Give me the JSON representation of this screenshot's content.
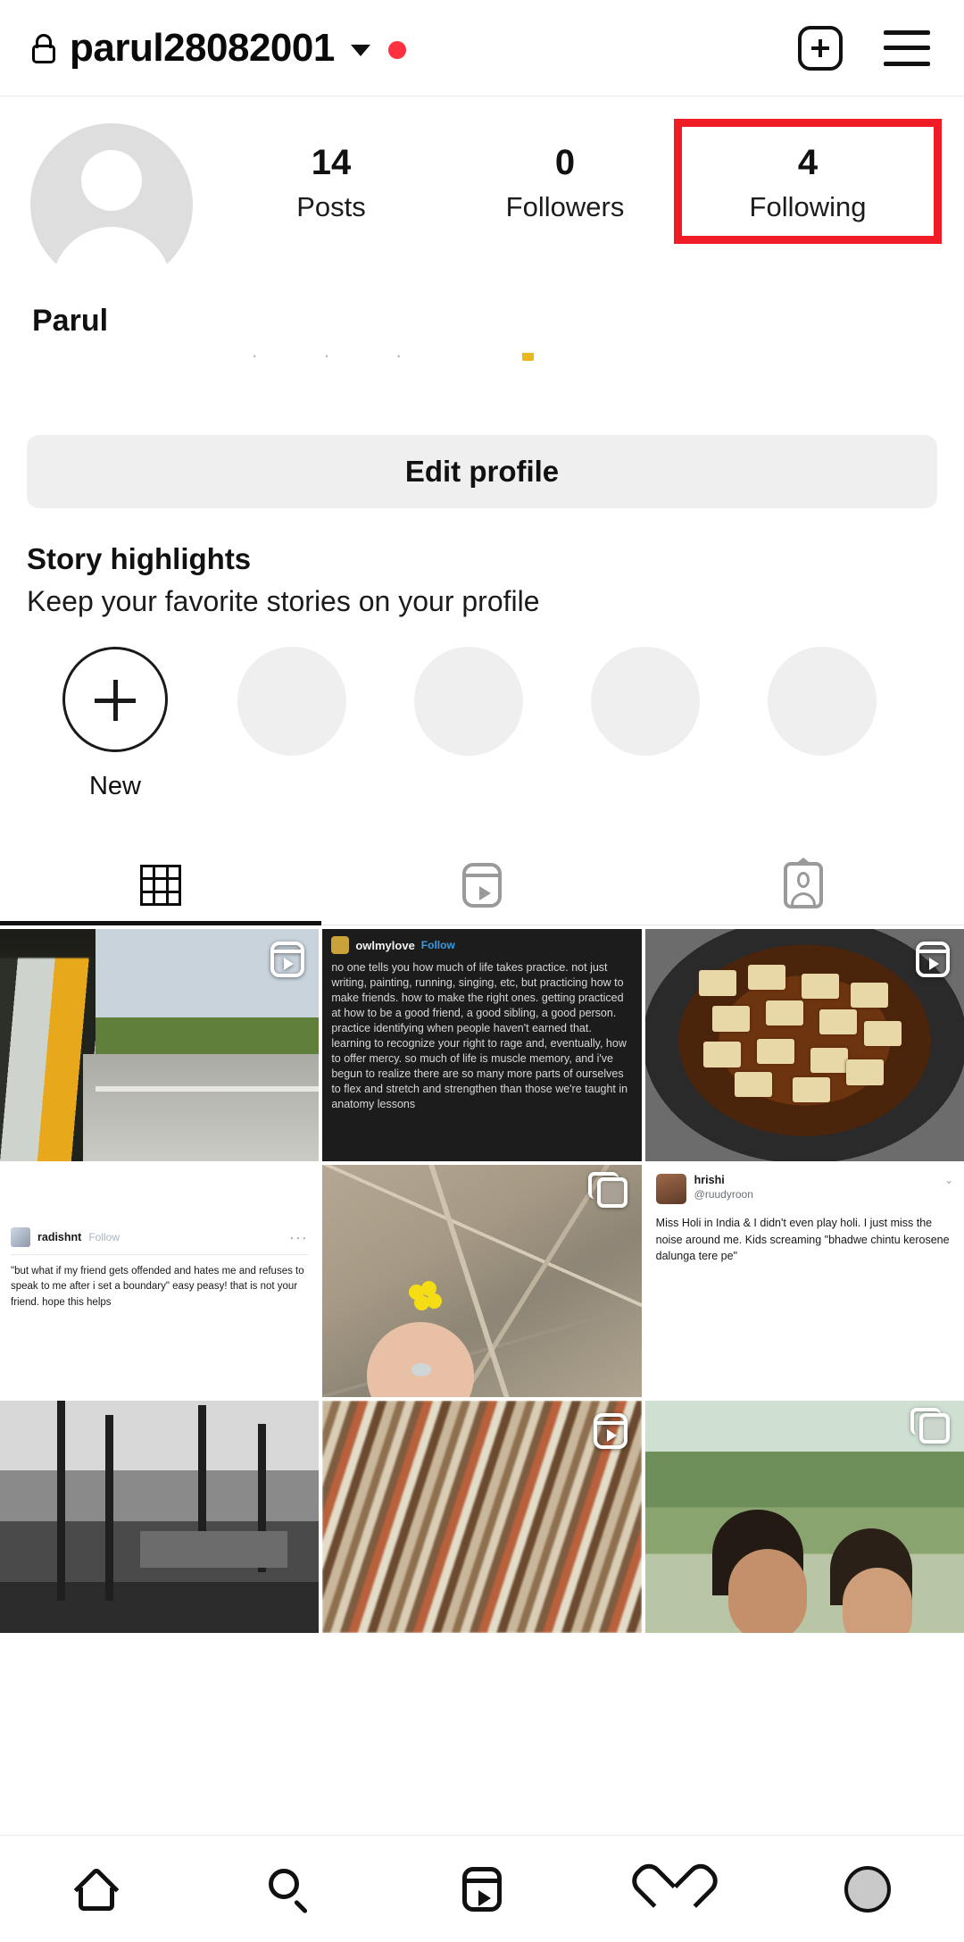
{
  "header": {
    "lock_icon": "lock-icon",
    "username": "parul28082001",
    "chevron_icon": "chevron-down-icon",
    "notification_dot": "red-dot-badge",
    "add_label": "add-post-button",
    "menu_label": "hamburger-menu-button"
  },
  "profile": {
    "avatar_alt": "default-avatar",
    "display_name": "Parul",
    "stats": [
      {
        "num": "14",
        "label": "Posts",
        "highlighted": false
      },
      {
        "num": "0",
        "label": "Followers",
        "highlighted": false
      },
      {
        "num": "4",
        "label": "Following",
        "highlighted": true
      }
    ],
    "highlight_color": "#ef1c26",
    "edit_profile_label": "Edit profile"
  },
  "highlights": {
    "title": "Story highlights",
    "subtitle": "Keep your favorite stories on your profile",
    "new_label": "New",
    "placeholder_count": 4
  },
  "tabs": [
    {
      "name": "grid",
      "icon": "grid-icon",
      "active": true
    },
    {
      "name": "reels",
      "icon": "reels-icon",
      "active": false
    },
    {
      "name": "tagged",
      "icon": "tagged-icon",
      "active": false
    }
  ],
  "posts": [
    {
      "id": "post-1",
      "kind": "photo-auto-rickshaw",
      "badge": "reel",
      "description": "View from inside an auto rickshaw on a road"
    },
    {
      "id": "post-2",
      "kind": "dark-text-screenshot",
      "badge": "none",
      "handle": "owlmylove",
      "follow_label": "Follow",
      "body": "no one tells you how much of life takes practice. not just writing, painting, running, singing, etc, but practicing how to make friends. how to make the right ones. getting practiced at how to be a good friend, a good sibling, a good person. practice identifying when people haven't earned that. learning to recognize your right to rage and, eventually, how to offer mercy. so much of life is muscle memory, and i've begun to realize there are so many more parts of ourselves to flex and stretch and strengthen than those we're taught in anatomy lessons",
      "italic_word": "right"
    },
    {
      "id": "post-3",
      "kind": "photo-food-pan",
      "badge": "reel",
      "description": "Paneer curry cooking in a black pan"
    },
    {
      "id": "post-4",
      "kind": "tumblr-screenshot",
      "badge": "none",
      "handle": "radishnt",
      "follow_label": "Follow",
      "menu_label": "···",
      "body": "\"but what if my friend gets offended and hates me and refuses to speak to me after i set a boundary\" easy peasy! that is not your friend. hope this helps"
    },
    {
      "id": "post-5",
      "kind": "photo-yellow-flower",
      "badge": "carousel",
      "description": "Hand holding a small yellow flower among dry twigs"
    },
    {
      "id": "post-6",
      "kind": "tweet-screenshot",
      "badge": "none",
      "handle": "hrishi",
      "at_handle": "@ruudyroon",
      "chevron_icon": "chevron-down-icon",
      "body": "Miss Holi in India & I didn't even play holi. I just miss the noise around me. Kids screaming \"bhadwe chintu kerosene dalunga tere pe\""
    },
    {
      "id": "post-7",
      "kind": "photo-bw-trees",
      "badge": "none",
      "description": "Black and white photo of trees and a structure"
    },
    {
      "id": "post-8",
      "kind": "photo-fabric-stack",
      "badge": "reel",
      "description": "Blurred stack of colorful folded fabrics"
    },
    {
      "id": "post-9",
      "kind": "photo-two-people-garden",
      "badge": "carousel",
      "description": "Two people smiling in a green garden"
    }
  ],
  "bottom_nav": [
    {
      "name": "home",
      "icon": "home-icon"
    },
    {
      "name": "search",
      "icon": "search-icon"
    },
    {
      "name": "reels",
      "icon": "reels-icon"
    },
    {
      "name": "activity",
      "icon": "heart-icon"
    },
    {
      "name": "profile",
      "icon": "avatar-icon"
    }
  ]
}
